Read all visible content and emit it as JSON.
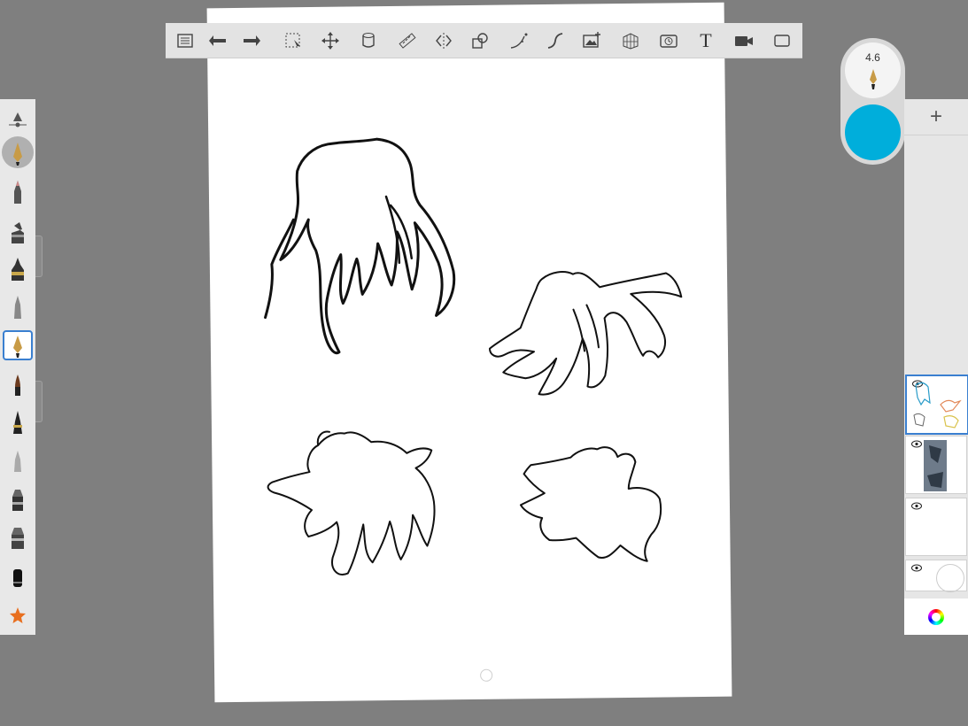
{
  "toolbar": {
    "icons": [
      "list-icon",
      "undo-icon",
      "redo-icon",
      "selection-icon",
      "transform-icon",
      "fill-icon",
      "ruler-icon",
      "symmetry-icon",
      "shape-icon",
      "stroke-guide-icon",
      "curve-icon",
      "image-icon",
      "perspective-icon",
      "timelapse-icon",
      "text-icon",
      "record-icon",
      "fullscreen-icon"
    ],
    "text_tool_label": "T"
  },
  "brush_palette": {
    "items": [
      "brush-settings",
      "fountain-pen",
      "pencil",
      "marker",
      "ink-pen",
      "airbrush",
      "fountain-pen-selected",
      "paintbrush",
      "brush-pen",
      "soft-pencil",
      "chisel",
      "flat-marker",
      "eraser",
      "favorites"
    ]
  },
  "brush_puck": {
    "size": "4.6",
    "color": "#00aedb"
  },
  "layers": {
    "add_label": "+",
    "items": [
      {
        "name": "layer-1",
        "visible": true,
        "active": true
      },
      {
        "name": "layer-2",
        "visible": true,
        "active": false
      },
      {
        "name": "layer-3",
        "visible": true,
        "active": false
      },
      {
        "name": "background-layer",
        "visible": true,
        "active": false
      }
    ]
  },
  "colors": {
    "accent": "#3a7fd0",
    "canvas": "#ffffff",
    "workspace": "#7f7f7f"
  }
}
